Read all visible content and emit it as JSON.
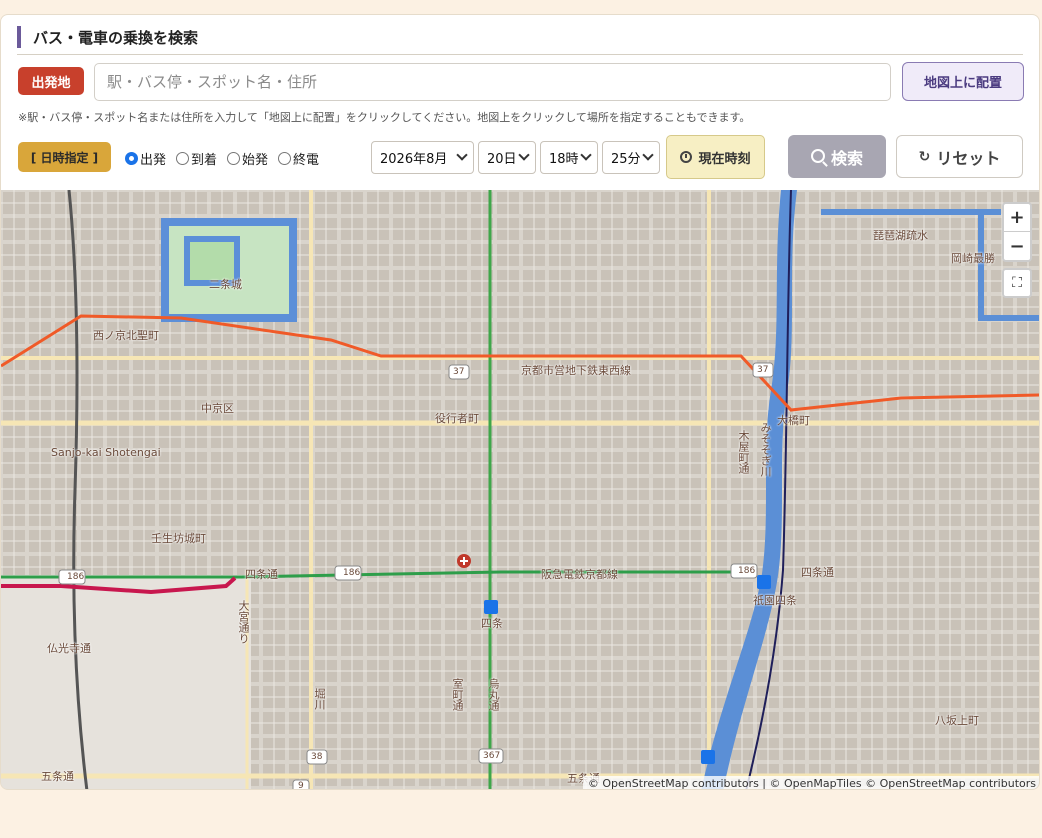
{
  "header": {
    "title": "バス・電車の乗換を検索"
  },
  "origin": {
    "badge": "出発地",
    "placeholder": "駅・バス停・スポット名・住所",
    "place_button": "地図上に配置",
    "hint": "※駅・バス停・スポット名または住所を入力して「地図上に配置」をクリックしてください。地図上をクリックして場所を指定することもできます。"
  },
  "datetime": {
    "badge": "[ 日時指定 ]",
    "modes": [
      {
        "label": "出発",
        "checked": true
      },
      {
        "label": "到着",
        "checked": false
      },
      {
        "label": "始発",
        "checked": false
      },
      {
        "label": "終電",
        "checked": false
      }
    ],
    "month": "2026年8月",
    "day": "20日",
    "hour": "18時",
    "minute": "25分",
    "now_button": "現在時刻"
  },
  "actions": {
    "search": "検索",
    "reset": "リセット"
  },
  "map": {
    "labels": {
      "nijo": "二条城",
      "nishinokyo": "西ノ京北聖町",
      "tozai": "京都市営地下鉄東西線",
      "hankyu": "阪急電鉄京都線",
      "shijo": "四条通",
      "shijo_st": "四条",
      "gion": "祇園四条",
      "sanjo": "Sanjo-kai Shotengai",
      "nakagyo": "中京区",
      "ebisugawa": "役行者町",
      "kamogawa": "みそそぎ川",
      "biwako": "琵琶湖疏水",
      "okazaki": "岡崎最勝",
      "muromachi": "室町通",
      "karasuma": "烏丸通",
      "horikawa": "堀川",
      "gojo": "五条通",
      "yasaka": "八坂上町",
      "kiyamachi": "木屋町通",
      "sanjo_ohashi": "大橋町",
      "mibu": "壬生坊城町",
      "omiya": "大宮通り",
      "bukkoji": "仏光寺通"
    },
    "road_numbers": [
      "186",
      "37",
      "367",
      "38",
      "9"
    ],
    "attribution": "© OpenStreetMap contributors | © OpenMapTiles © OpenStreetMap contributors"
  },
  "colors": {
    "accent": "#6b5a9a",
    "origin_badge": "#c8402c",
    "datetime_badge": "#d9a63a",
    "tozai_line": "#f05a28",
    "hankyu_line": "#2e9e4a",
    "river": "#5b8fd6"
  },
  "icons": {
    "zoom_in": "+",
    "zoom_out": "−",
    "fullscreen": "⛶",
    "reset": "↻"
  }
}
